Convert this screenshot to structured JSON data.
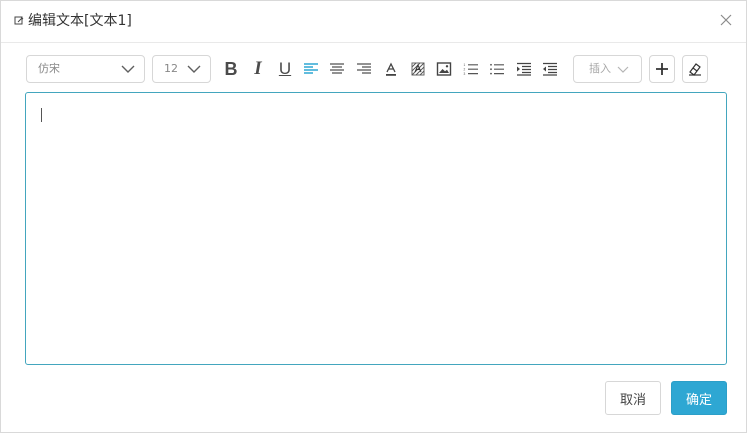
{
  "dialog": {
    "title": "编辑文本[文本1]",
    "icons": {
      "title": "edit-icon",
      "close": "close-icon"
    }
  },
  "toolbar": {
    "font_family": "仿宋",
    "font_size": "12",
    "bold_label": "B",
    "italic_label": "I",
    "underline_label": "U",
    "insert_label": "插入",
    "icons": {
      "align_left": "align-left-icon",
      "align_center": "align-center-icon",
      "align_right": "align-right-icon",
      "font_color": "font-color-icon",
      "background": "background-pattern-icon",
      "image": "image-icon",
      "ordered_list": "ordered-list-icon",
      "unordered_list": "unordered-list-icon",
      "indent": "indent-icon",
      "outdent": "outdent-icon",
      "add": "plus-icon",
      "eraser": "eraser-icon"
    }
  },
  "editor": {
    "content": ""
  },
  "footer": {
    "cancel_label": "取消",
    "confirm_label": "确定"
  },
  "colors": {
    "accent": "#2ea7d3",
    "active_icon": "#2ea7d3",
    "border": "#d7d7d7",
    "editor_border": "#43a6be"
  }
}
